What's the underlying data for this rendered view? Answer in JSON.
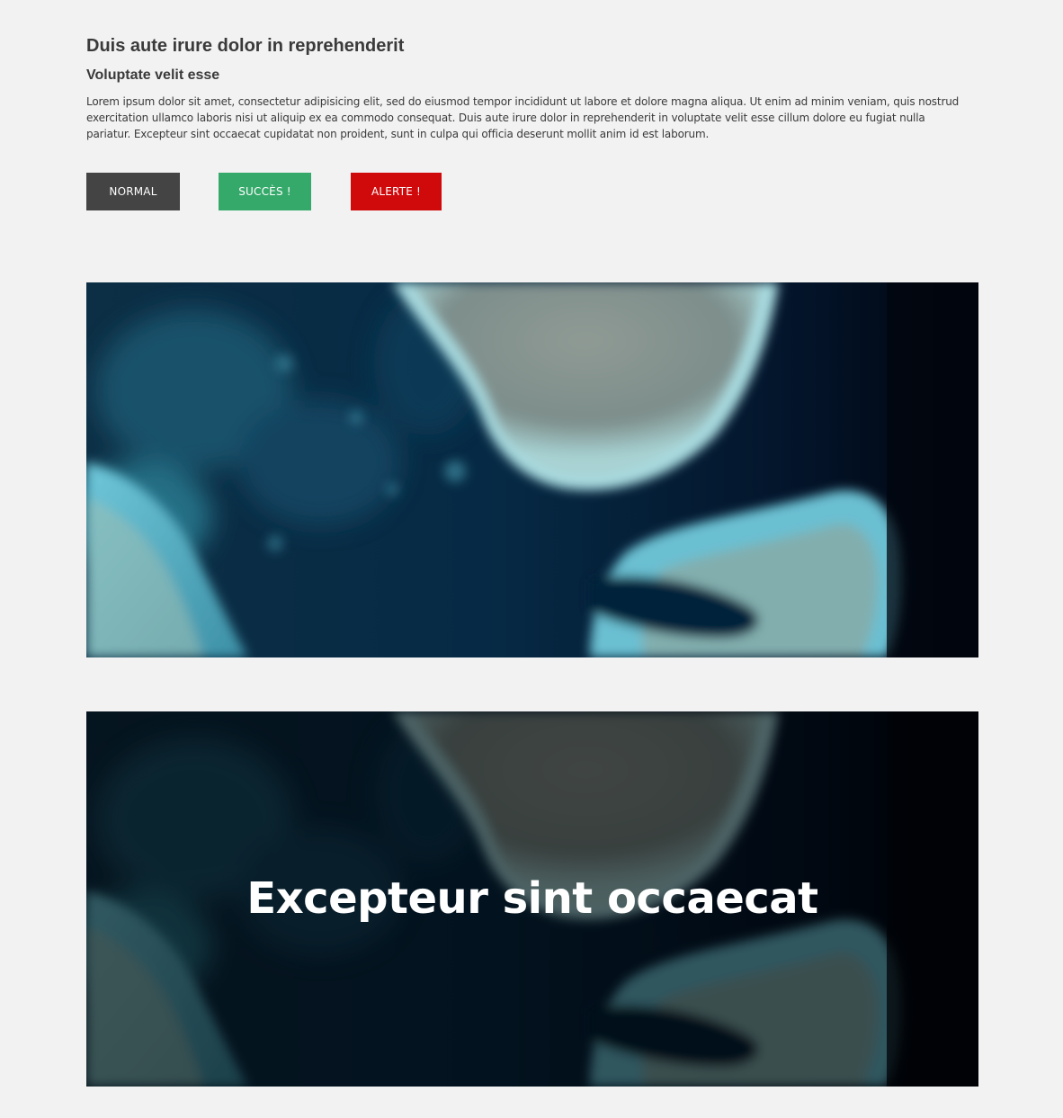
{
  "content": {
    "heading": "Duis aute irure dolor in reprehenderit",
    "subheading": "Voluptate velit esse",
    "paragraph": "Lorem ipsum dolor sit amet, consectetur adipisicing elit, sed do eiusmod tempor incididunt ut labore et dolore magna aliqua. Ut enim ad minim veniam, quis nostrud exercitation ullamco laboris nisi ut aliquip ex ea commodo consequat. Duis aute irure dolor in reprehenderit in voluptate velit esse cillum dolore eu fugiat nulla pariatur. Excepteur sint occaecat cupidatat non proident, sunt in culpa qui officia deserunt mollit anim id est laborum."
  },
  "buttons": {
    "normal": {
      "label": "NORMAL",
      "color": "#444444"
    },
    "success": {
      "label": "SUCCÈS !",
      "color": "#34a96a"
    },
    "alert": {
      "label": "ALERTE !",
      "color": "#d0090b"
    }
  },
  "banners": {
    "first": {
      "image": "aerial-reef-image"
    },
    "second": {
      "image": "aerial-reef-image",
      "title": "Excepteur sint occaecat"
    }
  },
  "colors": {
    "background": "#f2f2f2",
    "text": "#3a3a3a"
  }
}
